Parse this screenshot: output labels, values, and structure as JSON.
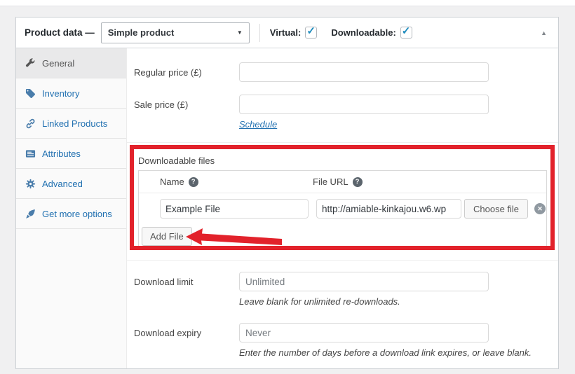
{
  "header": {
    "title": "Product data —",
    "product_type": {
      "value": "Simple product",
      "caret": "▼"
    },
    "virtual_label": "Virtual:",
    "downloadable_label": "Downloadable:",
    "virtual_checked": true,
    "downloadable_checked": true,
    "checkmark": "✓",
    "collapse_icon": "▲"
  },
  "sidebar": {
    "tabs": [
      {
        "label": "General",
        "icon": "wrench-icon",
        "active": true
      },
      {
        "label": "Inventory",
        "icon": "tag-icon",
        "active": false
      },
      {
        "label": "Linked Products",
        "icon": "link-icon",
        "active": false
      },
      {
        "label": "Attributes",
        "icon": "list-card-icon",
        "active": false
      },
      {
        "label": "Advanced",
        "icon": "gear-icon",
        "active": false
      },
      {
        "label": "Get more options",
        "icon": "pen-icon",
        "active": false
      }
    ]
  },
  "pricing": {
    "regular_price_label": "Regular price (£)",
    "regular_price_value": "",
    "sale_price_label": "Sale price (£)",
    "sale_price_value": "",
    "schedule_link": "Schedule"
  },
  "downloadable_files": {
    "section_label": "Downloadable files",
    "columns": {
      "name": "Name",
      "file_url": "File URL"
    },
    "help_icon_glyph": "?",
    "rows": [
      {
        "name": "Example File",
        "file_url": "http://amiable-kinkajou.w6.wp"
      }
    ],
    "choose_file_button": "Choose file",
    "delete_icon_glyph": "✕",
    "add_file_button": "Add File"
  },
  "download_limits": {
    "limit_label": "Download limit",
    "limit_placeholder": "Unlimited",
    "limit_help": "Leave blank for unlimited re-downloads.",
    "expiry_label": "Download expiry",
    "expiry_placeholder": "Never",
    "expiry_help": "Enter the number of days before a download link expires, or leave blank."
  },
  "colors": {
    "link_blue": "#2271b1",
    "icon_blue": "#4a7dab",
    "check_blue": "#1e8cbe",
    "annotation_red": "#e2222b",
    "active_tab_bg": "#e9e9ea"
  }
}
